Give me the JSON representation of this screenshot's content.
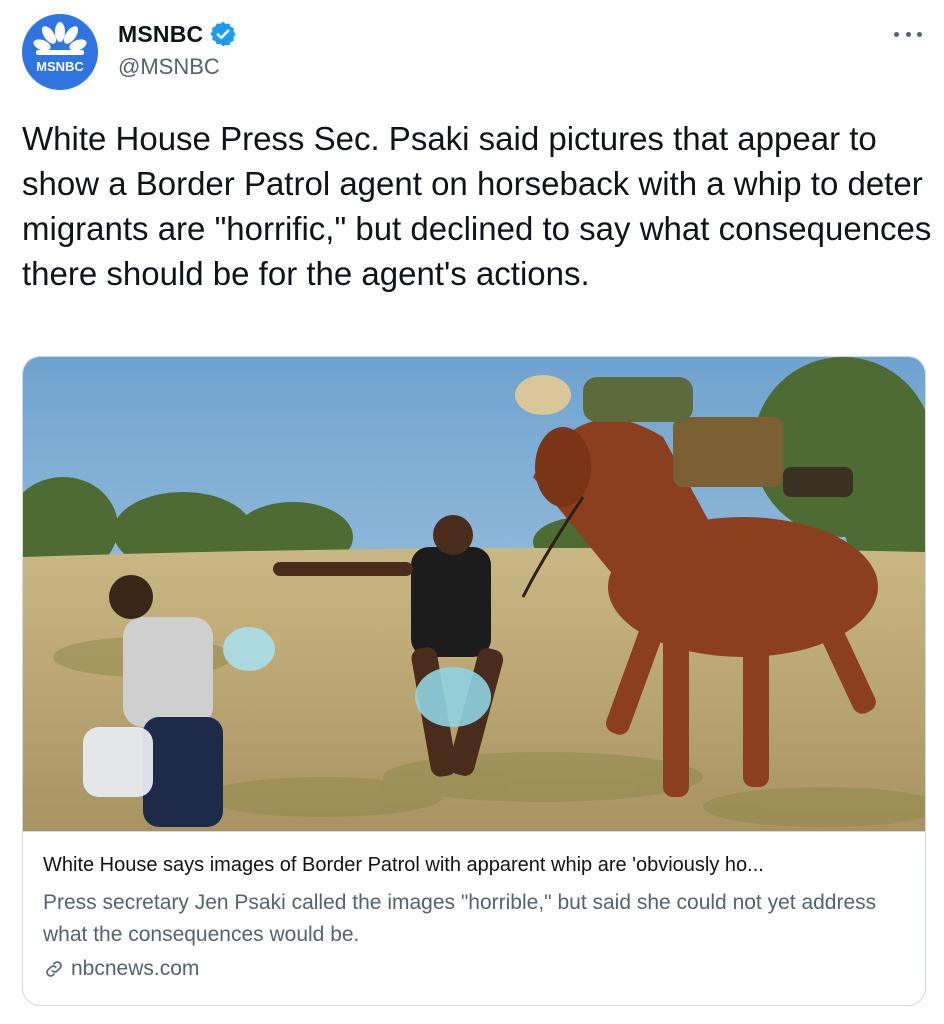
{
  "author": {
    "display_name": "MSNBC",
    "handle": "@MSNBC",
    "avatar_text": "MSNBC",
    "verified": true
  },
  "tweet": {
    "text": "White House Press Sec. Psaki said pictures that appear to show a Border Patrol agent on horseback with a whip to deter migrants are \"horrific,\" but declined to say what consequences there should be for the agent's actions."
  },
  "card": {
    "title": "White House says images of Border Patrol with apparent whip are 'obviously ho...",
    "description": "Press secretary Jen Psaki called the images \"horrible,\" but said she could not yet address what the consequences would be.",
    "domain": "nbcnews.com"
  },
  "icons": {
    "verified": "verified-badge-icon",
    "more": "more-options-icon",
    "link": "link-icon"
  },
  "colors": {
    "accent": "#1d9bf0",
    "avatar_bg": "#2f74e0",
    "text_primary": "#0f1419",
    "text_secondary": "#536471",
    "border": "#cfd9de"
  }
}
